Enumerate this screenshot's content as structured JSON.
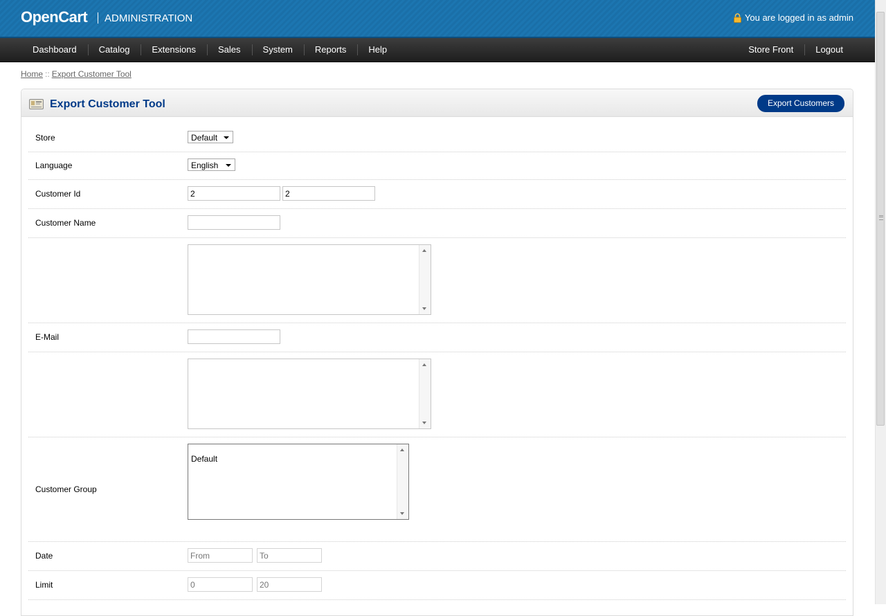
{
  "header": {
    "logo": "OpenCart",
    "section": "ADMINISTRATION",
    "logged_in_text": "You are logged in as admin"
  },
  "menu": {
    "left": [
      "Dashboard",
      "Catalog",
      "Extensions",
      "Sales",
      "System",
      "Reports",
      "Help"
    ],
    "right": [
      "Store Front",
      "Logout"
    ]
  },
  "breadcrumb": {
    "home": "Home",
    "separator": "::",
    "current": "Export Customer Tool"
  },
  "panel": {
    "title": "Export Customer Tool",
    "export_button": "Export Customers"
  },
  "form": {
    "store_label": "Store",
    "store_value": "Default",
    "language_label": "Language",
    "language_value": "English",
    "customer_id_label": "Customer Id",
    "customer_id_from": "2",
    "customer_id_to": "2",
    "customer_name_label": "Customer Name",
    "customer_name_value": "",
    "email_label": "E-Mail",
    "email_value": "",
    "customer_group_label": "Customer Group",
    "customer_group_options": [
      "Default"
    ],
    "date_label": "Date",
    "date_from_placeholder": "From",
    "date_to_placeholder": "To",
    "limit_label": "Limit",
    "limit_start_placeholder": "0",
    "limit_count_placeholder": "20"
  },
  "colors": {
    "header_blue": "#1a6fa8",
    "title_blue": "#003a88",
    "menu_dark": "#2b2b2b"
  },
  "icons": {
    "lock": "lock-icon",
    "heading": "customer-card-icon"
  }
}
